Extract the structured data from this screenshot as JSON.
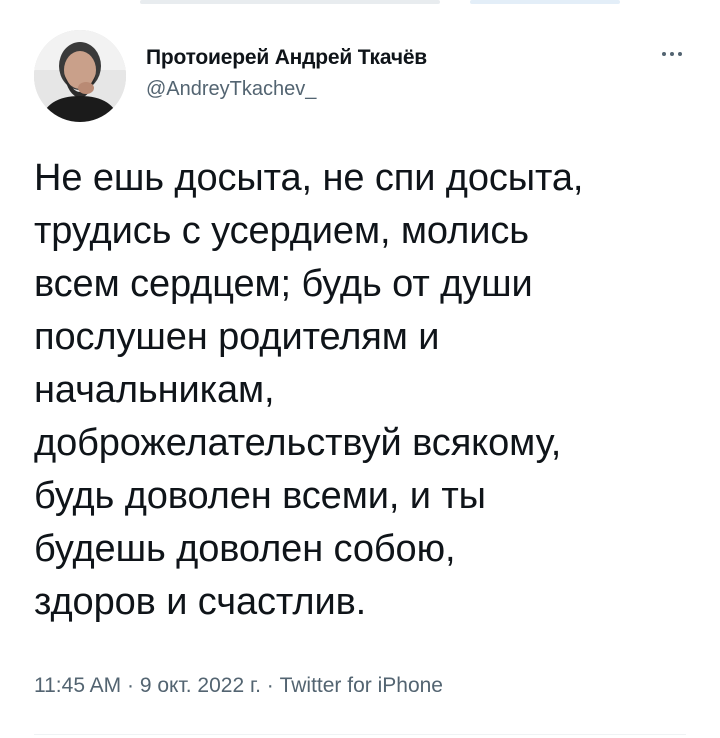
{
  "tweet": {
    "author": {
      "display_name": "Протоиерей Андрей Ткачёв",
      "handle": "@AndreyTkachev_",
      "avatar_icon": "person-avatar"
    },
    "more_icon": "more-horizontal-icon",
    "text": "Не ешь досыта, не спи досыта,\nтрудись с усердием, молись\nвсем сердцем; будь от души\nпослушен родителям и\nначальникам,\nдоброжелательствуй всякому,\nбудь доволен всеми, и ты\nбудешь доволен собою,\nздоров и счастлив.",
    "time": "11:45 AM",
    "date": "9 окт. 2022 г.",
    "separator": "·",
    "source": "Twitter for iPhone"
  },
  "colors": {
    "text_primary": "#0f1419",
    "text_secondary": "#536471",
    "divider": "#eff3f4"
  }
}
